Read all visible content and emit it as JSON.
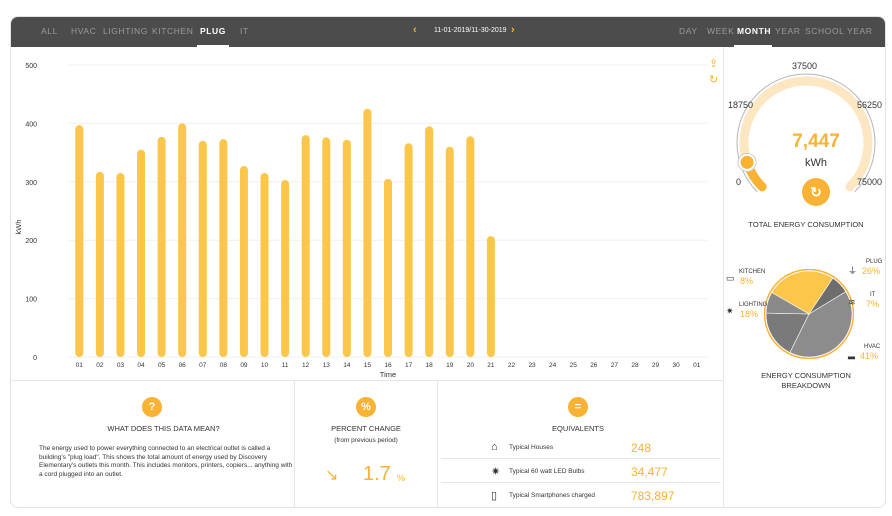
{
  "filters": [
    "ALL",
    "HVAC",
    "LIGHTING",
    "KITCHEN",
    "PLUG",
    "IT"
  ],
  "active_filter": "PLUG",
  "date_range": "11-01-2019/11-30-2019",
  "periods": [
    "DAY",
    "WEEK",
    "MONTH",
    "YEAR",
    "SCHOOL YEAR"
  ],
  "active_period": "MONTH",
  "icons": {
    "prev": "chevron-left-icon",
    "next": "chevron-right-icon",
    "export": "share-icon",
    "refresh": "refresh-icon"
  },
  "colors": {
    "accent": "#f9b233",
    "topbar": "#4c4c4d",
    "pie_gray": "#8c8c8c",
    "pie_dark": "#707070"
  },
  "chart_data": {
    "type": "bar",
    "ylabel": "kWh",
    "xlabel": "Time",
    "ylim": [
      0,
      500
    ],
    "yticks": [
      0,
      100,
      200,
      300,
      400,
      500
    ],
    "categories": [
      "01",
      "02",
      "03",
      "04",
      "05",
      "06",
      "07",
      "08",
      "09",
      "10",
      "11",
      "12",
      "13",
      "14",
      "15",
      "16",
      "17",
      "18",
      "19",
      "20",
      "21",
      "22",
      "23",
      "24",
      "25",
      "26",
      "27",
      "28",
      "29",
      "30",
      "01"
    ],
    "values": [
      397,
      317,
      315,
      355,
      377,
      400,
      370,
      373,
      327,
      315,
      303,
      380,
      376,
      372,
      425,
      305,
      366,
      395,
      360,
      378,
      207,
      null,
      null,
      null,
      null,
      null,
      null,
      null,
      null,
      null,
      null
    ],
    "grid": true,
    "color": "#fbc649"
  },
  "gauge": {
    "value": "7,447",
    "unit": "kWh",
    "min": "0",
    "q1": "18750",
    "mid": "37500",
    "q3": "56250",
    "max": "75000",
    "fraction": 0.0993,
    "title": "TOTAL ENERGY CONSUMPTION"
  },
  "breakdown": {
    "title_line1": "ENERGY CONSUMPTION",
    "title_line2": "BREAKDOWN",
    "slices": [
      {
        "name": "KITCHEN",
        "pct": "8%",
        "value": 8,
        "color": "#8a8a8a"
      },
      {
        "name": "PLUG",
        "pct": "26%",
        "value": 26,
        "color": "#fbc649"
      },
      {
        "name": "IT",
        "pct": "7%",
        "value": 7,
        "color": "#6d6d6d"
      },
      {
        "name": "HVAC",
        "pct": "41%",
        "value": 41,
        "color": "#8c8c8c"
      },
      {
        "name": "LIGHTING",
        "pct": "18%",
        "value": 18,
        "color": "#7a7a7a"
      }
    ]
  },
  "info": {
    "title": "WHAT DOES THIS DATA MEAN?",
    "text": "The energy used to power everything connected to an electrical outlet is called a building's \"plug load\". This shows the total amount of energy used by Discovery Elementary's outlets this month. This includes  monitors, printers, copiers... anything with a cord plugged into an outlet."
  },
  "percent_change": {
    "title": "PERCENT CHANGE",
    "subtitle": "(from previous period)",
    "value": "1.7",
    "unit": "%"
  },
  "equivalents": {
    "title": "EQUIVALENTS",
    "rows": [
      {
        "icon": "house-icon",
        "label": "Typical Houses",
        "value": "248"
      },
      {
        "icon": "lightbulb-icon",
        "label": "Typical 60 watt LED Bulbs",
        "value": "34,477"
      },
      {
        "icon": "smartphone-icon",
        "label": "Typical Smartphones charged",
        "value": "783,897"
      }
    ]
  }
}
